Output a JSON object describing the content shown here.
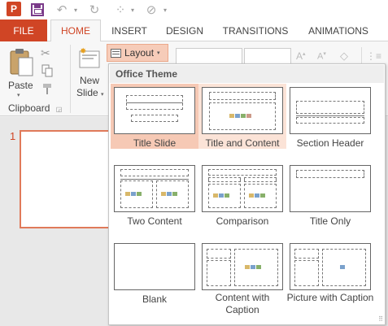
{
  "qat": {
    "app_logo": "P",
    "icons": [
      "powerpoint-logo",
      "save-icon",
      "undo-icon",
      "redo-icon",
      "touch-mode-icon",
      "shape-select-icon"
    ]
  },
  "tabs": {
    "file": "FILE",
    "items": [
      "HOME",
      "INSERT",
      "DESIGN",
      "TRANSITIONS",
      "ANIMATIONS"
    ],
    "active": "HOME"
  },
  "ribbon": {
    "paste_label": "Paste",
    "new_slide_label_1": "New",
    "new_slide_label_2": "Slide",
    "layout_label": "Layout",
    "clipboard_group": "Clipboard"
  },
  "slides": {
    "current_number": "1"
  },
  "gallery": {
    "header": "Office Theme",
    "items": [
      {
        "label": "Title Slide",
        "state": "selected"
      },
      {
        "label": "Title and Content",
        "state": "hovered"
      },
      {
        "label": "Section Header",
        "state": "normal"
      },
      {
        "label": "Two Content",
        "state": "normal"
      },
      {
        "label": "Comparison",
        "state": "normal"
      },
      {
        "label": "Title Only",
        "state": "normal"
      },
      {
        "label": "Blank",
        "state": "normal"
      },
      {
        "label": "Content with Caption",
        "state": "normal"
      },
      {
        "label": "Picture with Caption",
        "state": "normal"
      }
    ]
  },
  "colors": {
    "accent": "#d04525",
    "selected_bg": "#f6c9b5",
    "hover_bg": "#fbe3d7"
  }
}
